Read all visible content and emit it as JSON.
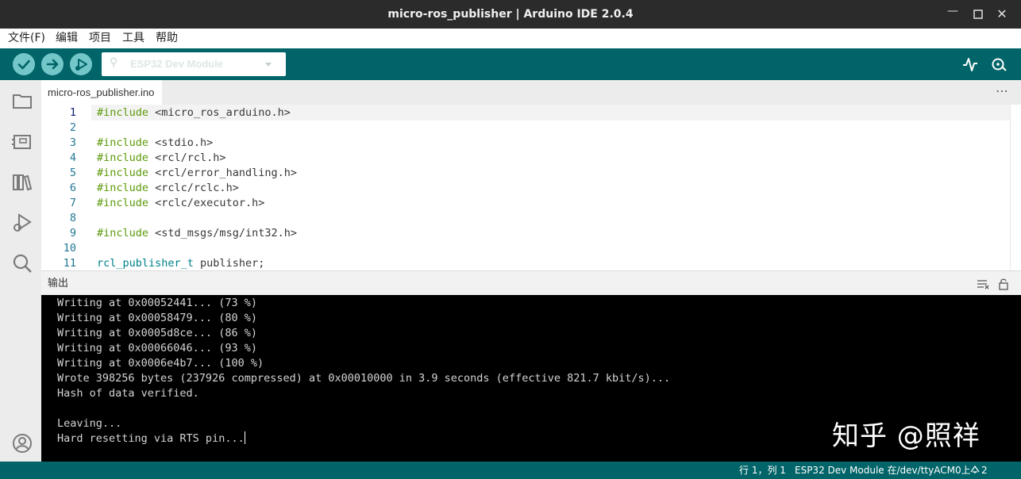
{
  "window": {
    "title": "micro-ros_publisher | Arduino IDE 2.0.4",
    "controls": [
      "minimize-icon",
      "maximize-icon",
      "close-icon"
    ]
  },
  "menu": [
    "文件(F)",
    "编辑",
    "项目",
    "工具",
    "帮助"
  ],
  "toolbar": {
    "verify_icon": "checkmark-icon",
    "upload_icon": "arrow-right-icon",
    "debug_icon": "debug-play-icon",
    "board_icon": "usb-icon",
    "board_name": "ESP32 Dev Module",
    "serial_plotter_icon": "serial-plotter-icon",
    "serial_monitor_icon": "serial-monitor-icon"
  },
  "sidebar": [
    "folder-icon",
    "boards-manager-icon",
    "library-manager-icon",
    "debug-icon",
    "search-icon",
    "account-icon"
  ],
  "editor": {
    "tab": "micro-ros_publisher.ino",
    "more": "⋯",
    "lines": [
      {
        "n": "1",
        "parts": [
          [
            "kw",
            "#include"
          ],
          [
            "str",
            " <micro_ros_arduino.h>"
          ]
        ]
      },
      {
        "n": "2",
        "parts": []
      },
      {
        "n": "3",
        "parts": [
          [
            "kw",
            "#include"
          ],
          [
            "str",
            " <stdio.h>"
          ]
        ]
      },
      {
        "n": "4",
        "parts": [
          [
            "kw",
            "#include"
          ],
          [
            "str",
            " <rcl/rcl.h>"
          ]
        ]
      },
      {
        "n": "5",
        "parts": [
          [
            "kw",
            "#include"
          ],
          [
            "str",
            " <rcl/error_handling.h>"
          ]
        ]
      },
      {
        "n": "6",
        "parts": [
          [
            "kw",
            "#include"
          ],
          [
            "str",
            " <rclc/rclc.h>"
          ]
        ]
      },
      {
        "n": "7",
        "parts": [
          [
            "kw",
            "#include"
          ],
          [
            "str",
            " <rclc/executor.h>"
          ]
        ]
      },
      {
        "n": "8",
        "parts": []
      },
      {
        "n": "9",
        "parts": [
          [
            "kw",
            "#include"
          ],
          [
            "str",
            " <std_msgs/msg/int32.h>"
          ]
        ]
      },
      {
        "n": "10",
        "parts": []
      },
      {
        "n": "11",
        "parts": [
          [
            "type",
            "rcl_publisher_t"
          ],
          [
            "plain",
            " publisher;"
          ]
        ]
      }
    ]
  },
  "output": {
    "title": "输出",
    "clear_icon": "clear-output-icon",
    "lock_icon": "lock-icon",
    "lines": [
      "Writing at 0x00052441... (73 %)",
      "Writing at 0x00058479... (80 %)",
      "Writing at 0x0005d8ce... (86 %)",
      "Writing at 0x00066046... (93 %)",
      "Writing at 0x0006e4b7... (100 %)",
      "Wrote 398256 bytes (237926 compressed) at 0x00010000 in 3.9 seconds (effective 821.7 kbit/s)...",
      "Hash of data verified.",
      "",
      "Leaving...",
      "Hard resetting via RTS pin..."
    ],
    "watermark": "知乎 @照祥"
  },
  "status": {
    "position": "行 1，列 1",
    "board": "ESP32 Dev Module 在/dev/ttyACM0上",
    "notifications_icon": "notification-icon",
    "notifications": "2"
  },
  "colors": {
    "teal": "#006468",
    "button": "#74c7c9",
    "keyword": "#5c9a0a",
    "type": "#00818a",
    "line_number": "#237893"
  }
}
